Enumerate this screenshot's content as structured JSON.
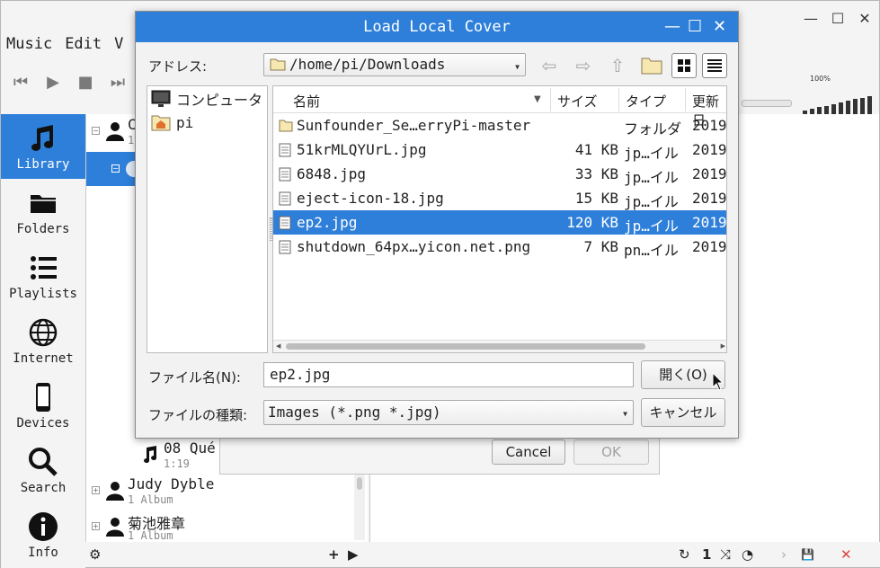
{
  "app": {
    "menu": [
      "Music",
      "Edit",
      "V"
    ],
    "window_controls": [
      "—",
      "☐",
      "✕"
    ],
    "volume_percent": "100%",
    "volume_level": 1.0
  },
  "sidebar": {
    "items": [
      {
        "label": "Library",
        "icon": "music-note-icon"
      },
      {
        "label": "Folders",
        "icon": "folder-icon"
      },
      {
        "label": "Playlists",
        "icon": "list-icon"
      },
      {
        "label": "Internet",
        "icon": "globe-icon"
      },
      {
        "label": "Devices",
        "icon": "phone-icon"
      },
      {
        "label": "Search",
        "icon": "search-icon"
      },
      {
        "label": "Info",
        "icon": "info-icon"
      }
    ]
  },
  "library": {
    "row0": {
      "name": "C",
      "sub": "1"
    },
    "track": {
      "name": "08 Qué",
      "duration": "1:19"
    },
    "artist1": {
      "name": "Judy Dyble",
      "sub": "1 Album"
    },
    "artist2": {
      "name": "菊池雅章",
      "sub": "1 Album"
    }
  },
  "bottombar": {
    "left": [
      "⚙",
      "+",
      "▶"
    ],
    "right": [
      "↻",
      "1",
      "⤨",
      "◔",
      "›",
      "💾",
      "✕"
    ]
  },
  "bg_dialog": {
    "cancel": "Cancel",
    "ok": "OK"
  },
  "dialog": {
    "title": "Load Local Cover",
    "address_label": "アドレス:",
    "address": "/home/pi/Downloads",
    "places": [
      "コンピュータ",
      "pi"
    ],
    "columns": {
      "name": "名前",
      "size": "サイズ",
      "type": "タイプ",
      "date": "更新日"
    },
    "files": [
      {
        "name": "Sunfounder_Se…erryPi-master",
        "size": "",
        "type": "フォルダ",
        "date": "2019",
        "kind": "folder"
      },
      {
        "name": "51krMLQYUrL.jpg",
        "size": "41 KB",
        "type": "jp…イル",
        "date": "2019",
        "kind": "file"
      },
      {
        "name": "6848.jpg",
        "size": "33 KB",
        "type": "jp…イル",
        "date": "2019",
        "kind": "file"
      },
      {
        "name": "eject-icon-18.jpg",
        "size": "15 KB",
        "type": "jp…イル",
        "date": "2019",
        "kind": "file"
      },
      {
        "name": "ep2.jpg",
        "size": "120 KB",
        "type": "jp…イル",
        "date": "2019",
        "kind": "file"
      },
      {
        "name": "shutdown_64px…yicon.net.png",
        "size": "7 KB",
        "type": "pn…イル",
        "date": "2019",
        "kind": "file"
      }
    ],
    "selected_file": "ep2.jpg",
    "filename_label": "ファイル名(N):",
    "filename_value": "ep2.jpg",
    "filetype_label": "ファイルの種類:",
    "filetype_value": "Images (*.png *.jpg)",
    "open_button": "開く(O)",
    "cancel_button": "キャンセル"
  },
  "colors": {
    "accent": "#2e7fd9"
  }
}
